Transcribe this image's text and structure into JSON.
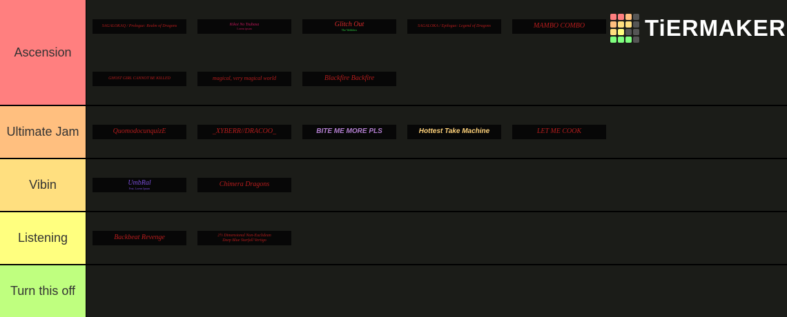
{
  "colors": {
    "ascension": "#ff7f7f",
    "ultimate_jam": "#ffbf7f",
    "vibin": "#ffdf7f",
    "listening": "#ffff7f",
    "turn_this_off": "#bfff7f",
    "item_text_red": "#b81d1d"
  },
  "logo": {
    "text": "TiERMAKER",
    "icon": "tiermaker-grid-icon"
  },
  "tiers": [
    {
      "label": "Ascension",
      "items": [
        {
          "title": "SAGALOKAQ / Prologue: Realm of Dragons",
          "sub": ""
        },
        {
          "title": "Kikoi No Tsubasa",
          "sub": "Lorem ipsum"
        },
        {
          "title": "Glitch Out",
          "sub": "The Wobblers"
        },
        {
          "title": "SAGALOKA / Epilogue: Legend of Dragons",
          "sub": ""
        },
        {
          "title": "MAMBO COMBO",
          "sub": ""
        },
        {
          "title": "GHOST GIRL CANNOT BE KILLED",
          "sub": ""
        },
        {
          "title": "magical, very magical world",
          "sub": ""
        },
        {
          "title": "Blackfire Backfire",
          "sub": ""
        }
      ]
    },
    {
      "label": "Ultimate Jam",
      "items": [
        {
          "title": "QuomodocunquizE",
          "sub": ""
        },
        {
          "title": "_XYBERR//DRACOO_",
          "sub": ""
        },
        {
          "title": "BITE ME MORE PLS",
          "sub": ""
        },
        {
          "title": "Hottest Take Machine",
          "sub": ""
        },
        {
          "title": "LET ME COOK",
          "sub": ""
        }
      ]
    },
    {
      "label": "Vibin",
      "items": [
        {
          "title": "UmbRal",
          "sub": "Feat. Lorem Ipsum"
        },
        {
          "title": "Chimera Dragons",
          "sub": ""
        }
      ]
    },
    {
      "label": "Listening",
      "items": [
        {
          "title": "Backbeat Revenge",
          "sub": ""
        },
        {
          "title": "2½ Dimensional Non-Euclidean",
          "sub": "Deep Blue Starfall Vertigo"
        }
      ]
    },
    {
      "label": "Turn this off",
      "items": []
    }
  ]
}
